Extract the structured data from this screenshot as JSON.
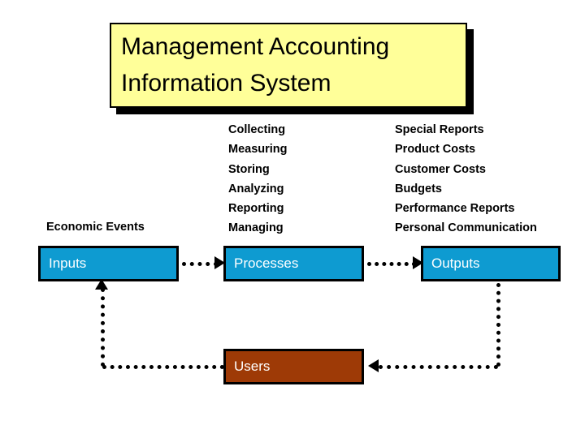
{
  "title": {
    "line1": "Management Accounting",
    "line2": "Information System",
    "background_color": "#FFFF99",
    "border_color": "#000000",
    "text_color": "#000000"
  },
  "labels": {
    "economic_events": "Economic Events"
  },
  "columns": {
    "processes_activities": [
      "Collecting",
      "Measuring",
      "Storing",
      "Analyzing",
      "Reporting",
      "Managing"
    ],
    "outputs_items": [
      "Special Reports",
      "Product Costs",
      "Customer Costs",
      "Budgets",
      "Performance Reports",
      "Personal Communication"
    ]
  },
  "flow": {
    "boxes": [
      {
        "id": "inputs",
        "label": "Inputs",
        "color": "#0E9BD1",
        "text_color": "#FFFFFF"
      },
      {
        "id": "processes",
        "label": "Processes",
        "color": "#0E9BD1",
        "text_color": "#FFFFFF"
      },
      {
        "id": "outputs",
        "label": "Outputs",
        "color": "#0E9BD1",
        "text_color": "#FFFFFF"
      },
      {
        "id": "users",
        "label": "Users",
        "color": "#9E3A06",
        "text_color": "#FFFFFF"
      }
    ],
    "connectors": [
      {
        "from": "inputs",
        "to": "processes",
        "style": "dotted",
        "arrow": "right"
      },
      {
        "from": "processes",
        "to": "outputs",
        "style": "dotted",
        "arrow": "right"
      },
      {
        "from": "outputs",
        "to": "users",
        "style": "dotted",
        "arrow": "left"
      },
      {
        "from": "users",
        "to": "inputs",
        "style": "dotted",
        "arrow": "up"
      }
    ]
  }
}
